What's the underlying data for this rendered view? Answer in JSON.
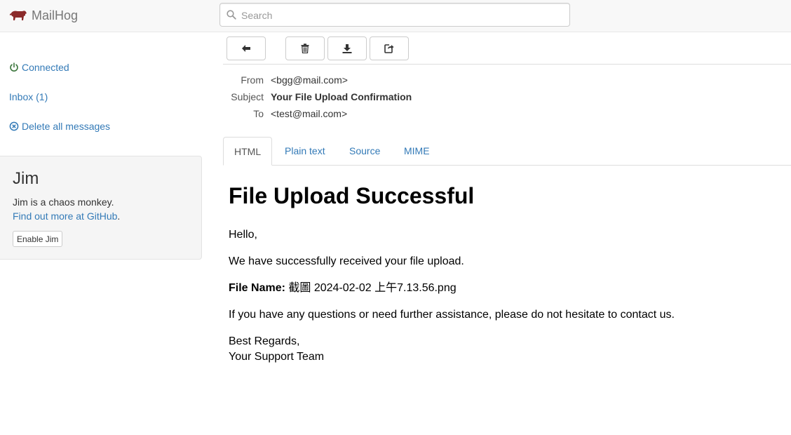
{
  "app": {
    "title": "MailHog"
  },
  "search": {
    "placeholder": "Search"
  },
  "sidebar": {
    "connected": "Connected",
    "inbox": "Inbox (1)",
    "delete_all": "Delete all messages"
  },
  "jim": {
    "title": "Jim",
    "description": "Jim is a chaos monkey.",
    "link_text": "Find out more at GitHub",
    "link_suffix": ".",
    "button": "Enable Jim"
  },
  "toolbar": {
    "back": "arrow-left-icon",
    "delete": "trash-icon",
    "download": "download-icon",
    "release": "share-icon"
  },
  "message": {
    "from_label": "From",
    "from_value": "<bgg@mail.com>",
    "subject_label": "Subject",
    "subject_value": "Your File Upload Confirmation",
    "to_label": "To",
    "to_value": "<test@mail.com>"
  },
  "tabs": [
    {
      "label": "HTML",
      "active": true
    },
    {
      "label": "Plain text",
      "active": false
    },
    {
      "label": "Source",
      "active": false
    },
    {
      "label": "MIME",
      "active": false
    }
  ],
  "email_body": {
    "heading": "File Upload Successful",
    "greeting": "Hello,",
    "received": "We have successfully received your file upload.",
    "file_label": "File Name:",
    "file_name": " 截圖 2024-02-02 上午7.13.56.png",
    "questions": "If you have any questions or need further assistance, please do not hesitate to contact us.",
    "regards": "Best Regards,",
    "team": "Your Support Team"
  },
  "colors": {
    "link": "#337ab7",
    "connected": "#3c763d",
    "brand_icon": "#8b2a2a"
  }
}
